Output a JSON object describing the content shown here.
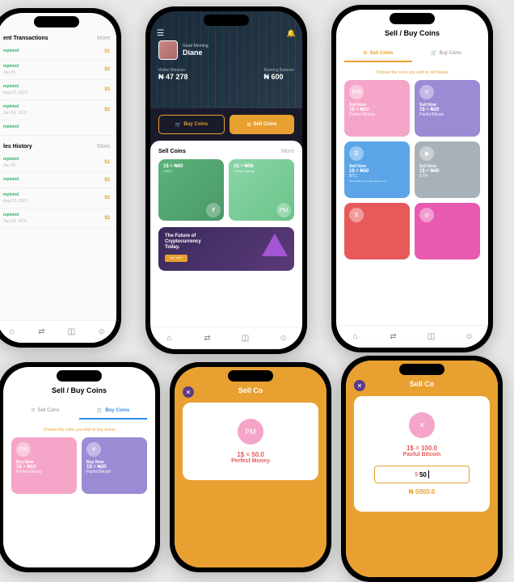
{
  "p1": {
    "title": "ent Transactions",
    "more": "More",
    "rows": [
      {
        "status": "mpleted",
        "date": "",
        "amt": "$1"
      },
      {
        "status": "mpleted",
        "date": "Jan 05",
        "amt": "$2"
      },
      {
        "status": "mpleted",
        "date": "Aug 03, 2023",
        "amt": "$3"
      },
      {
        "status": "mpleted",
        "date": "Jan 04, 1970",
        "amt": "$2"
      },
      {
        "status": "mpleted",
        "date": "",
        "amt": ""
      }
    ],
    "sales_title": "les History",
    "srows": [
      {
        "status": "mpleted",
        "date": "Jan 05",
        "amt": "$1"
      },
      {
        "status": "mpleted",
        "date": "",
        "amt": "$2"
      },
      {
        "status": "mpleted",
        "date": "Aug 03, 2023",
        "amt": "$3"
      },
      {
        "status": "mpleted",
        "date": "Jan 04, 1970",
        "amt": "$2"
      }
    ]
  },
  "p2": {
    "greet": "Good Morning",
    "name": "Diane",
    "wallet_lbl": "Wallet Balance",
    "wallet_val": "₦ 47 278",
    "bank_lbl": "Banking Balance",
    "bank_val": "₦ 600",
    "buy": "Buy Coins",
    "sell": "Sell Coins",
    "sell_hdr": "Sell Coins",
    "more": "More",
    "card1_rate": "1$ = ₦80",
    "card1_name": "USDT",
    "card2_rate": "1$ = ₦56",
    "card2_name": "Perfect Money",
    "banner1": "The Future of",
    "banner2": "Cryptocurrency",
    "banner3": "Today.",
    "banner_btn": "BUY NOW"
  },
  "p3": {
    "title": "Sell / Buy Coins",
    "tab_sell": "Sell Coins",
    "tab_buy": "Buy Coins",
    "choose": "Choose the coins you wish to sell below",
    "cards": [
      {
        "lbl": "Sell Now",
        "rate": "1$ = ₦10",
        "name": "Perfect Money",
        "cls": "gc-pink",
        "ic": "PM"
      },
      {
        "lbl": "Sell Now",
        "rate": "1$ = ₦20",
        "name": "Paxful Bitcoin",
        "cls": "gc-purple",
        "ic": "✕"
      },
      {
        "lbl": "Sell Now",
        "rate": "1$ = ₦30",
        "name": "BTC",
        "sub": "(Blockchain, Coinbase, Bitcoin etc)",
        "cls": "gc-blue",
        "ic": "₿"
      },
      {
        "lbl": "Sell Now",
        "rate": "1$ = ₦40",
        "name": "ETH",
        "cls": "gc-grey",
        "ic": "◆"
      },
      {
        "lbl": "",
        "rate": "",
        "name": "",
        "cls": "gc-red",
        "ic": "$"
      },
      {
        "lbl": "",
        "rate": "",
        "name": "",
        "cls": "gc-mag",
        "ic": "◎"
      }
    ]
  },
  "p4": {
    "title": "Sell / Buy Coins",
    "tab_sell": "Sell Coins",
    "tab_buy": "Buy Coins",
    "choose": "Choose the coins you wish to buy below",
    "cards": [
      {
        "lbl": "Buy Now",
        "rate": "1$ = ₦10",
        "name": "Perfect Money",
        "cls": "gc-pink",
        "ic": "PM"
      },
      {
        "lbl": "Buy Now",
        "rate": "1$ = ₦20",
        "name": "Paxful Bitcoin",
        "cls": "gc-purple",
        "ic": "✕"
      }
    ]
  },
  "p5": {
    "title": "Sell Co",
    "rate": "1$ = 50.0",
    "name": "Perfect Money",
    "ic": "PM"
  },
  "p6": {
    "title": "Sell Co",
    "rate": "1$ = 100.0",
    "name": "Paxful Bitcoin",
    "ic": "✕",
    "dollar": "$",
    "input": "50",
    "output": "₦ 5000.0"
  }
}
